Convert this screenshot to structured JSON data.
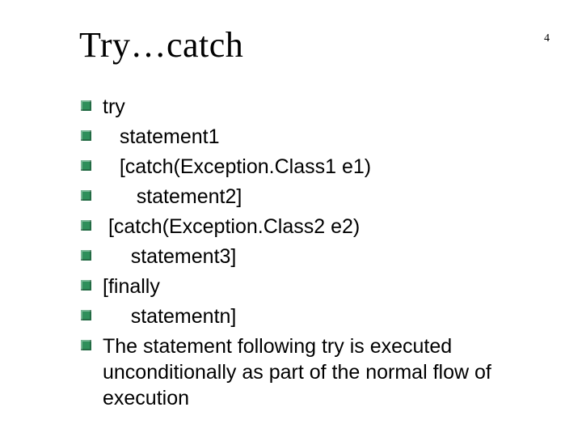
{
  "header": {
    "title": "Try…catch",
    "page_number": "4"
  },
  "body": {
    "items": [
      {
        "text": "try"
      },
      {
        "text": "   statement1"
      },
      {
        "text": "   [catch(Exception.Class1 e1)"
      },
      {
        "text": "      statement2]"
      },
      {
        "text": " [catch(Exception.Class2 e2)"
      },
      {
        "text": "     statement3]"
      },
      {
        "text": "[finally"
      },
      {
        "text": "     statementn]"
      },
      {
        "text": "The statement following try is executed unconditionally as part of the normal flow of execution"
      }
    ]
  }
}
